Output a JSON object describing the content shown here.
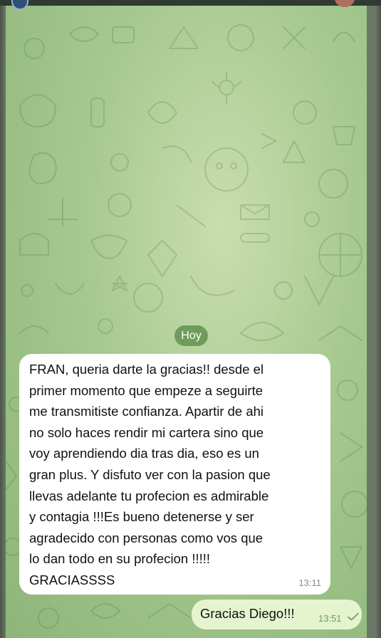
{
  "colors": {
    "chat_background": "#a6c990",
    "day_pill": "#6f9c5c",
    "incoming_bubble": "#ffffff",
    "outgoing_bubble": "#e5f4cf",
    "outgoing_time": "#6a9b5a"
  },
  "day_separator": {
    "label": "Hoy"
  },
  "messages": [
    {
      "direction": "incoming",
      "text": "FRAN, queria darte la gracias!! desde el\nprimer momento que empeze a seguirte\nme transmitiste confianza. Apartir de ahi\nno solo haces rendir mi cartera sino que\nvoy aprendiendo dia tras dia, eso es un\ngran plus. Y disfuto ver con la pasion que\nllevas adelante tu profecion es admirable\ny contagia !!!Es bueno detenerse y ser\nagradecido con personas como vos que\nlo dan todo en su profecion !!!!!\nGRACIASSSS",
      "time": "13:11"
    },
    {
      "direction": "outgoing",
      "text": "Gracias Diego!!!",
      "time": "13:51",
      "status_icon": "single-check-icon"
    }
  ]
}
